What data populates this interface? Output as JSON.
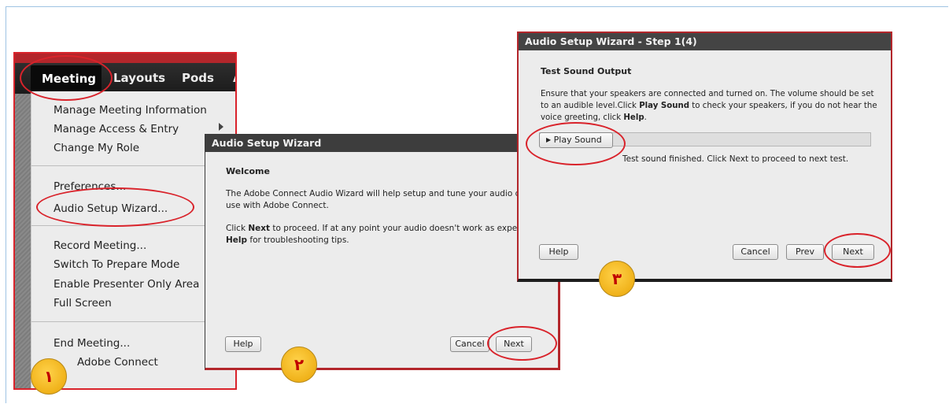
{
  "menu": {
    "bar_items": [
      "Meeting",
      "Layouts",
      "Pods"
    ],
    "bar_partial": "A",
    "items": [
      "Manage Meeting Information",
      "Manage Access & Entry",
      "Change My Role",
      "Preferences...",
      "Audio Setup Wizard...",
      "Record Meeting...",
      "Switch To Prepare Mode",
      "Enable Presenter Only Area",
      "Full Screen",
      "End Meeting...",
      "Adobe Connect"
    ]
  },
  "dialog1": {
    "title": "Audio Setup Wizard",
    "heading": "Welcome",
    "para1_line1": "The Adobe Connect Audio Wizard will help setup and tune your audio device",
    "para1_line2": "use with Adobe Connect.",
    "para2_pre": "Click ",
    "para2_bold": "Next",
    "para2_post": " to proceed. If at any point your audio doesn't work as expected, cli",
    "para2_bold2": "Help",
    "para2_post2": " for troubleshooting tips.",
    "help_label": "Help",
    "cancel_label": "Cancel",
    "next_label": "Next"
  },
  "dialog2": {
    "title": "Audio Setup Wizard - Step 1(4)",
    "heading": "Test Sound Output",
    "line1": "Ensure that your speakers are connected and turned on. The volume should be set",
    "line2_pre": "to an audible level.Click ",
    "line2_bold": "Play Sound",
    "line2_post": " to check your speakers, if you do not hear the",
    "line3_pre": "voice greeting, click ",
    "line3_bold": "Help",
    "line3_post": ".",
    "play_label": "Play Sound",
    "status": "Test sound finished. Click Next to proceed to next test.",
    "help_label": "Help",
    "cancel_label": "Cancel",
    "prev_label": "Prev",
    "next_label": "Next"
  },
  "badges": [
    "١",
    "٢",
    "٣"
  ],
  "colors": {
    "annotation_red": "#d9232b",
    "badge_gold": "#f0b21a",
    "title_bar": "#3d3d3d"
  }
}
